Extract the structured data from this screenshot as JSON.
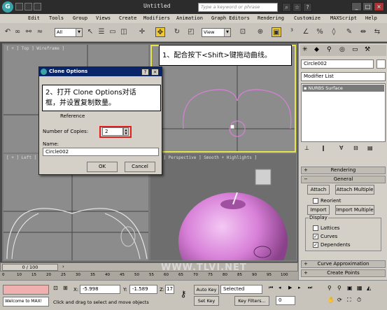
{
  "app": {
    "title": "Untitled",
    "search_placeholder": "Type a keyword or phrase",
    "logo_letter": "G"
  },
  "menu": [
    "Edit",
    "Tools",
    "Group",
    "Views",
    "Create",
    "Modifiers",
    "Animation",
    "Graph Editors",
    "Rendering",
    "Customize",
    "MAXScript",
    "Help"
  ],
  "toolbar": {
    "selection_filter": "All",
    "coord_system": "View"
  },
  "viewports": {
    "top": "[ + ] Top ] Wireframe ]",
    "left": "[ + ] Left ] Wireframe ]",
    "persp": "[ + ] Perspective ] Smooth + Highlights ]"
  },
  "callouts": {
    "c1": "1、配合按下<Shift>键拖动曲线。",
    "c2_line1": "2、打开 Clone Options对话",
    "c2_line2": "框，并设置复制数量。"
  },
  "dialog": {
    "title": "Clone Options",
    "close_label": "×",
    "help_label": "?",
    "reference_label": "Reference",
    "copies_label": "Number of Copies:",
    "copies_value": "2",
    "name_label": "Name:",
    "name_value": "Circle002",
    "ok_label": "OK",
    "cancel_label": "Cancel"
  },
  "command_panel": {
    "object_name": "Circle002",
    "modifier_list": "Modifier List",
    "stack_item": "NURBS Surface",
    "rollouts": {
      "rendering": "Rendering",
      "general": "General",
      "attach": "Attach",
      "attach_multiple": "Attach Multiple",
      "reorient": "Reorient",
      "import": "Import",
      "import_multiple": "Import Multiple",
      "display": "Display",
      "lattices": "Lattices",
      "curves": "Curves",
      "dependents": "Dependents",
      "curve_approximation": "Curve Approximation",
      "create_points": "Create Points"
    }
  },
  "timeline": {
    "frame": "0 / 100",
    "ticks": [
      "0",
      "10",
      "15",
      "20",
      "25",
      "30",
      "35",
      "40",
      "45",
      "50",
      "55",
      "60",
      "65",
      "70",
      "75",
      "80",
      "85",
      "90",
      "95",
      "100"
    ]
  },
  "status": {
    "welcome": "Welcome to MAX!",
    "prompt": "Click and drag to select and move objects",
    "x_label": "X:",
    "x_value": "-5.998",
    "y_label": "Y:",
    "y_value": "-1.589",
    "z_label": "Z:",
    "z_value": "17",
    "auto_key": "Auto Key",
    "set_key": "Set Key",
    "selected": "Selected",
    "key_filters": "Key Filters...",
    "frame_value": "0",
    "watermark": "WWW.TLVI.NET"
  },
  "colors": {
    "accent_yellow": "#e6e64a",
    "highlight_red": "#e02020",
    "dialog_title": "#0a246a",
    "object_pink": "#d880d8"
  }
}
